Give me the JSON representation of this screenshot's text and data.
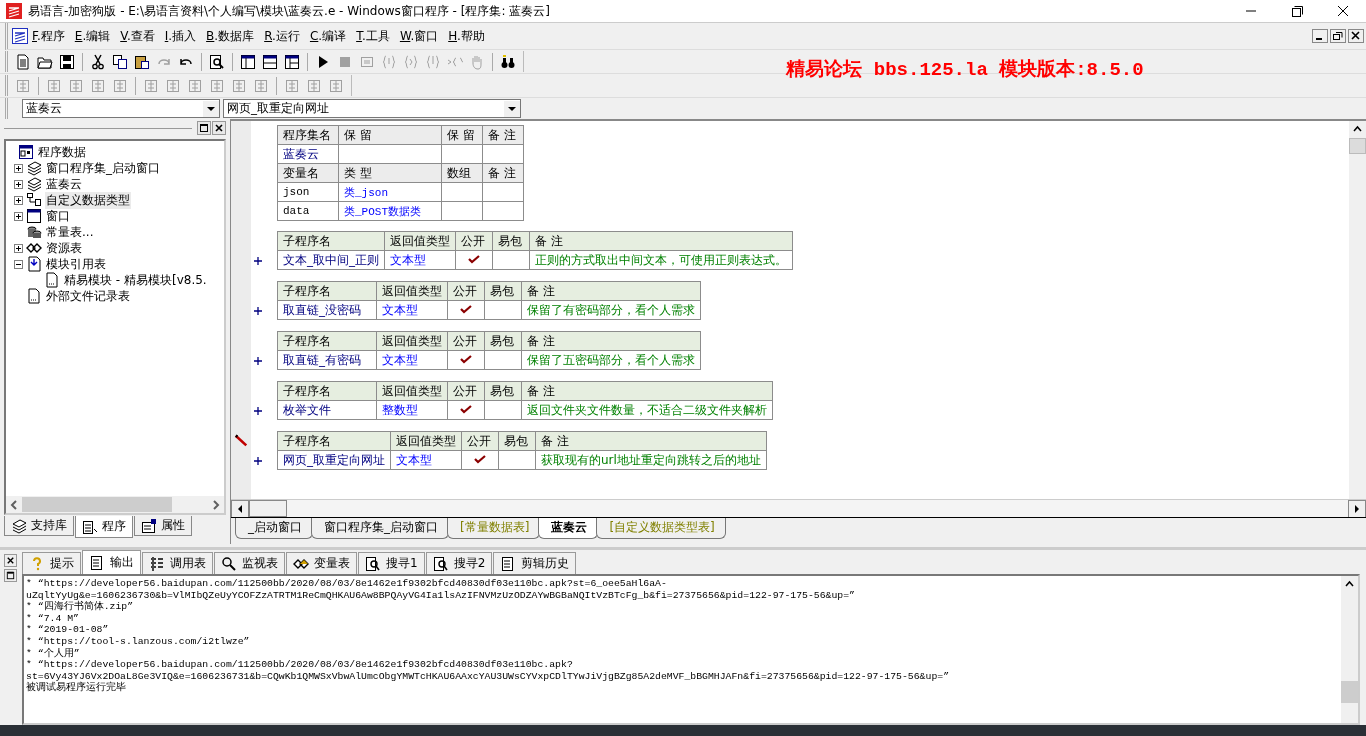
{
  "window": {
    "title": "易语言-加密狗版 - E:\\易语言资料\\个人编写\\模块\\蓝奏云.e - Windows窗口程序 - [程序集: 蓝奏云]"
  },
  "menu": [
    {
      "label": "F.程序"
    },
    {
      "label": "E.编辑"
    },
    {
      "label": "V.查看"
    },
    {
      "label": "I.插入"
    },
    {
      "label": "B.数据库"
    },
    {
      "label": "R.运行"
    },
    {
      "label": "C.编译"
    },
    {
      "label": "T.工具"
    },
    {
      "label": "W.窗口"
    },
    {
      "label": "H.帮助"
    }
  ],
  "toolbars": [
    {
      "groups": [
        [
          {
            "disabled": false
          },
          {
            "disabled": false
          },
          {
            "disabled": false
          }
        ],
        [
          {
            "disabled": false
          },
          {
            "disabled": false
          },
          {
            "disabled": false
          },
          {
            "disabled": true
          },
          {
            "disabled": false
          }
        ],
        [
          {
            "disabled": false
          }
        ],
        [
          {
            "disabled": false
          },
          {
            "disabled": false
          },
          {
            "disabled": false
          }
        ],
        [
          {
            "disabled": false
          },
          {
            "disabled": true
          },
          {
            "disabled": true
          },
          {
            "disabled": true
          },
          {
            "disabled": true
          },
          {
            "disabled": true
          },
          {
            "disabled": true
          },
          {
            "disabled": true
          }
        ],
        [
          {
            "disabled": false
          }
        ]
      ]
    },
    {
      "groups": [
        [
          {
            "disabled": true
          }
        ],
        [
          {
            "disabled": true
          },
          {
            "disabled": true
          },
          {
            "disabled": true
          },
          {
            "disabled": true
          }
        ],
        [
          {
            "disabled": true
          },
          {
            "disabled": true
          },
          {
            "disabled": true
          },
          {
            "disabled": true
          },
          {
            "disabled": true
          },
          {
            "disabled": true
          }
        ],
        [
          {
            "disabled": true
          },
          {
            "disabled": true
          },
          {
            "disabled": true
          }
        ]
      ]
    }
  ],
  "banner": "精易论坛 bbs.125.la 模块版本:8.5.0",
  "selectors": [
    {
      "value": "蓝奏云"
    },
    {
      "value": "网页_取重定向网址"
    }
  ],
  "tree": {
    "items": [
      {
        "label": "程序数据",
        "kind": "root",
        "selected": false,
        "children": [
          {
            "label": "窗口程序集_启动窗口",
            "kind": "assembly",
            "expanded": false,
            "selected": false
          },
          {
            "label": "蓝奏云",
            "kind": "assembly",
            "expanded": false,
            "selected": false
          },
          {
            "label": "自定义数据类型",
            "kind": "types",
            "expanded": false,
            "selected": true
          },
          {
            "label": "窗口",
            "kind": "window",
            "expanded": false,
            "selected": false
          },
          {
            "label": "常量表...",
            "kind": "constants",
            "selected": false
          },
          {
            "label": "资源表",
            "kind": "resources",
            "expanded": false,
            "selected": false
          },
          {
            "label": "模块引用表",
            "kind": "modules",
            "expanded": true,
            "selected": false,
            "children": [
              {
                "label": "精易模块 - 精易模块[v8.5.",
                "kind": "file",
                "selected": false
              }
            ]
          },
          {
            "label": "外部文件记录表",
            "kind": "file",
            "selected": false
          }
        ]
      }
    ]
  },
  "panel_tabs": [
    {
      "label": "支持库",
      "selected": false
    },
    {
      "label": "程序",
      "selected": true
    },
    {
      "label": "属性",
      "selected": false
    }
  ],
  "code": {
    "assembly": {
      "header": [
        "程序集名",
        "保 留",
        "保 留",
        "备 注"
      ],
      "row": {
        "name": "蓝奏云"
      },
      "var_header": [
        "变量名",
        "类 型",
        "数组",
        "备 注"
      ],
      "vars": [
        {
          "name": "json",
          "type": "类_json"
        },
        {
          "name": "data",
          "type": "类_POST数据类"
        }
      ]
    },
    "subroutines": [
      {
        "header": [
          "子程序名",
          "返回值类型",
          "公开",
          "易包",
          "备 注"
        ],
        "name": "文本_取中间_正则",
        "type": "文本型",
        "public": true,
        "easy_package": false,
        "note": "正则的方式取出中间文本，可使用正则表达式。",
        "current": false
      },
      {
        "header": [
          "子程序名",
          "返回值类型",
          "公开",
          "易包",
          "备 注"
        ],
        "name": "取直链_没密码",
        "type": "文本型",
        "public": true,
        "easy_package": false,
        "note": "保留了有密码部分，看个人需求",
        "current": false
      },
      {
        "header": [
          "子程序名",
          "返回值类型",
          "公开",
          "易包",
          "备 注"
        ],
        "name": "取直链_有密码",
        "type": "文本型",
        "public": true,
        "easy_package": false,
        "note": "保留了五密码部分，看个人需求",
        "current": false
      },
      {
        "header": [
          "子程序名",
          "返回值类型",
          "公开",
          "易包",
          "备 注"
        ],
        "name": "枚举文件",
        "type": "整数型",
        "public": true,
        "easy_package": false,
        "note": "返回文件夹文件数量，不适合二级文件夹解析",
        "current": false
      },
      {
        "header": [
          "子程序名",
          "返回值类型",
          "公开",
          "易包",
          "备 注"
        ],
        "name": "网页_取重定向网址",
        "type": "文本型",
        "public": true,
        "easy_package": false,
        "note": "获取现有的url地址重定向跳转之后的地址",
        "current": true
      }
    ]
  },
  "editor_tabs": [
    {
      "label": "_启动窗口",
      "kind": "program",
      "selected": false
    },
    {
      "label": "窗口程序集_启动窗口",
      "kind": "program",
      "selected": false
    },
    {
      "label": "[常量数据表]",
      "kind": "data",
      "selected": false
    },
    {
      "label": "蓝奏云",
      "kind": "program",
      "selected": true
    },
    {
      "label": "[自定义数据类型表]",
      "kind": "data",
      "selected": false
    }
  ],
  "output_tabs": [
    {
      "label": "提示",
      "selected": false
    },
    {
      "label": "输出",
      "selected": true
    },
    {
      "label": "调用表",
      "selected": false
    },
    {
      "label": "监视表",
      "selected": false
    },
    {
      "label": "变量表",
      "selected": false
    },
    {
      "label": "搜寻1",
      "selected": false
    },
    {
      "label": "搜寻2",
      "selected": false
    },
    {
      "label": "剪辑历史",
      "selected": false
    }
  ],
  "output_lines": [
    "* “https://developer56.baidupan.com/112500bb/2020/08/03/8e1462e1f9302bfcd40830df03e110bc.apk?st=6_oee5aHl6aA-",
    "uZqltYyUg&e=1606236730&b=VlMIbQZeUyYCOFZzATRTM1ReCmQHKAU6Aw8BPQAyVG4Ia1lsAzIFNVMzUzODZAYwBGBaNQItVzBTcFg_b&fi=27375656&pid=122-97-175-56&up=”",
    "* “四海行书简体.zip”",
    "* “7.4 M”",
    "* “2019-01-08”",
    "* “https://tool-s.lanzous.com/i2tlwze”",
    "* “个人用”",
    "* “https://developer56.baidupan.com/112500bb/2020/08/03/8e1462e1f9302bfcd40830df03e110bc.apk?",
    "st=6Vy43YJ6Vx2DOaL8Ge3VIQ&e=1606236731&b=CQwKb1QMWSxVbwAlUmcObgYMWTcHKAU6AAxcYAU3UWsCYVxpCDlTYwJiVjgBZg85A2deMVF_bBGMHJAFn&fi=27375656&pid=122-97-175-56&up=”",
    "被调试易程序运行完毕"
  ]
}
